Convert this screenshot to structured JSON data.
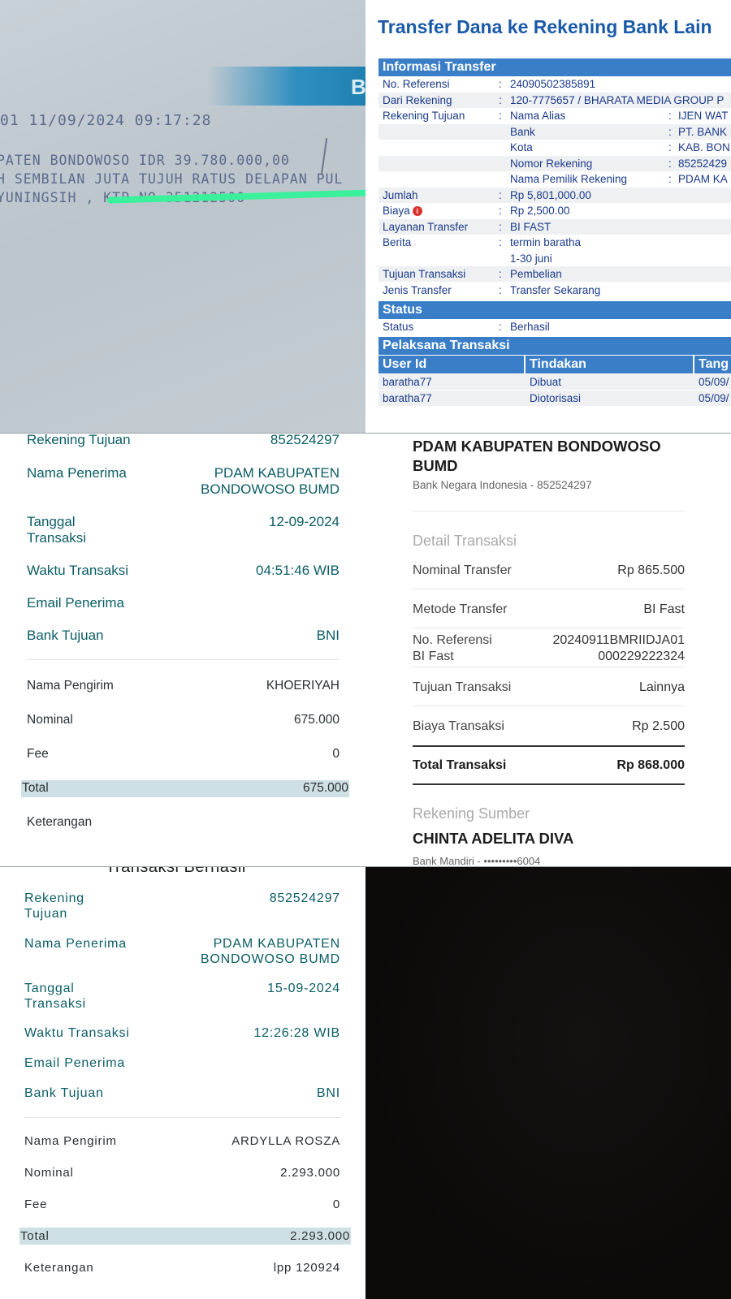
{
  "slip": {
    "line1": "01   11/09/2024 09:17:28",
    "line2": "PATEN BONDOWOSO IDR 39.780.000,00",
    "line3": "H SEMBILAN JUTA TUJUH RATUS DELAPAN PUL",
    "line4": "YUNINGSIH , KTP NO  351212500",
    "band_letter": "B"
  },
  "web_transfer": {
    "title": "Transfer Dana ke Rekening Bank Lain",
    "section_info": "Informasi Transfer",
    "rows": {
      "no_ref": {
        "label": "No. Referensi",
        "value": "24090502385891"
      },
      "dari_rekening": {
        "label": "Dari Rekening",
        "value": "120-7775657 / BHARATA MEDIA GROUP P"
      },
      "rekening_tujuan": {
        "label": "Rekening Tujuan",
        "sub_label": "Nama Alias",
        "sub_value": "IJEN WAT"
      },
      "bank": {
        "sub_label": "Bank",
        "sub_value": "PT. BANK"
      },
      "kota": {
        "sub_label": "Kota",
        "sub_value": "KAB. BON"
      },
      "nomor_rekening": {
        "sub_label": "Nomor Rekening",
        "sub_value": "85252429"
      },
      "nama_pemilik": {
        "sub_label": "Nama Pemilik Rekening",
        "sub_value": "PDAM KA"
      },
      "jumlah": {
        "label": "Jumlah",
        "value": "Rp 5,801,000.00"
      },
      "biaya": {
        "label": "Biaya",
        "value": "Rp 2,500.00"
      },
      "layanan": {
        "label": "Layanan Transfer",
        "value": "BI FAST"
      },
      "berita": {
        "label": "Berita",
        "value": "termin baratha",
        "value2": "1-30 juni"
      },
      "tujuan": {
        "label": "Tujuan Transaksi",
        "value": " Pembelian"
      },
      "jenis": {
        "label": "Jenis Transfer",
        "value": "Transfer Sekarang"
      }
    },
    "colon": ":",
    "section_status": "Status",
    "status": {
      "label": "Status",
      "value": " Berhasil"
    },
    "section_pelaksana": "Pelaksana Transaksi",
    "table_headers": {
      "user": "User Id",
      "action": "Tindakan",
      "date": "Tang"
    },
    "table_rows": [
      {
        "user": "baratha77",
        "action": "Dibuat",
        "date": "05/09/"
      },
      {
        "user": "baratha77",
        "action": "Diotorisasi",
        "date": "05/09/"
      }
    ]
  },
  "receipt_a": {
    "rekening_tujuan": {
      "label": "Rekening Tujuan",
      "value": "852524297"
    },
    "nama_penerima": {
      "label": "Nama Penerima",
      "value1": "PDAM KABUPATEN",
      "value2": "BONDOWOSO BUMD"
    },
    "tanggal": {
      "label1": "Tanggal",
      "label2": "Transaksi",
      "value": "12-09-2024"
    },
    "waktu": {
      "label": "Waktu Transaksi",
      "value": "04:51:46 WIB"
    },
    "email": {
      "label": "Email Penerima"
    },
    "bank": {
      "label": "Bank Tujuan",
      "value": "BNI"
    },
    "pengirim": {
      "label": "Nama Pengirim",
      "value": "KHOERIYAH"
    },
    "nominal": {
      "label": "Nominal",
      "value": "675.000"
    },
    "fee": {
      "label": "Fee",
      "value": "0"
    },
    "total": {
      "label": "Total",
      "value": "675.000"
    },
    "keterangan": {
      "label": "Keterangan"
    }
  },
  "bank_detail": {
    "recipient1": "PDAM KABUPATEN BONDOWOSO",
    "recipient2": "BUMD",
    "recipient_bank": "Bank Negara Indonesia - 852524297",
    "section_detail": "Detail Transaksi",
    "nominal": {
      "label": "Nominal Transfer",
      "value": "Rp 865.500"
    },
    "metode": {
      "label": "Metode Transfer",
      "value": "BI Fast"
    },
    "ref": {
      "label1": "No. Referensi",
      "label2": "BI Fast",
      "value1": "20240911BMRIIDJA01",
      "value2": "000229222324"
    },
    "tujuan": {
      "label": "Tujuan Transaksi",
      "value": "Lainnya"
    },
    "biaya": {
      "label": "Biaya Transaksi",
      "value": "Rp 2.500"
    },
    "total": {
      "label": "Total Transaksi",
      "value": "Rp 868.000"
    },
    "section_sumber": "Rekening Sumber",
    "source_name": "CHINTA ADELITA DIVA",
    "source_bank": "Bank Mandiri - •••••••••6004"
  },
  "receipt_b": {
    "header": "Transaksi Berhasil",
    "rekening_tujuan": {
      "label1": "Rekening",
      "label2": "Tujuan",
      "value": "852524297"
    },
    "nama_penerima": {
      "label": "Nama Penerima",
      "value1": "PDAM KABUPATEN",
      "value2": "BONDOWOSO BUMD"
    },
    "tanggal": {
      "label1": "Tanggal",
      "label2": "Transaksi",
      "value": "15-09-2024"
    },
    "waktu": {
      "label": "Waktu Transaksi",
      "value": "12:26:28 WIB"
    },
    "email": {
      "label": "Email Penerima"
    },
    "bank": {
      "label": "Bank Tujuan",
      "value": "BNI"
    },
    "pengirim": {
      "label": "Nama Pengirim",
      "value": "ARDYLLA ROSZA"
    },
    "nominal": {
      "label": "Nominal",
      "value": "2.293.000"
    },
    "fee": {
      "label": "Fee",
      "value": "0"
    },
    "total": {
      "label": "Total",
      "value": "2.293.000"
    },
    "keterangan": {
      "label": "Keterangan",
      "value": "lpp 120924"
    }
  }
}
